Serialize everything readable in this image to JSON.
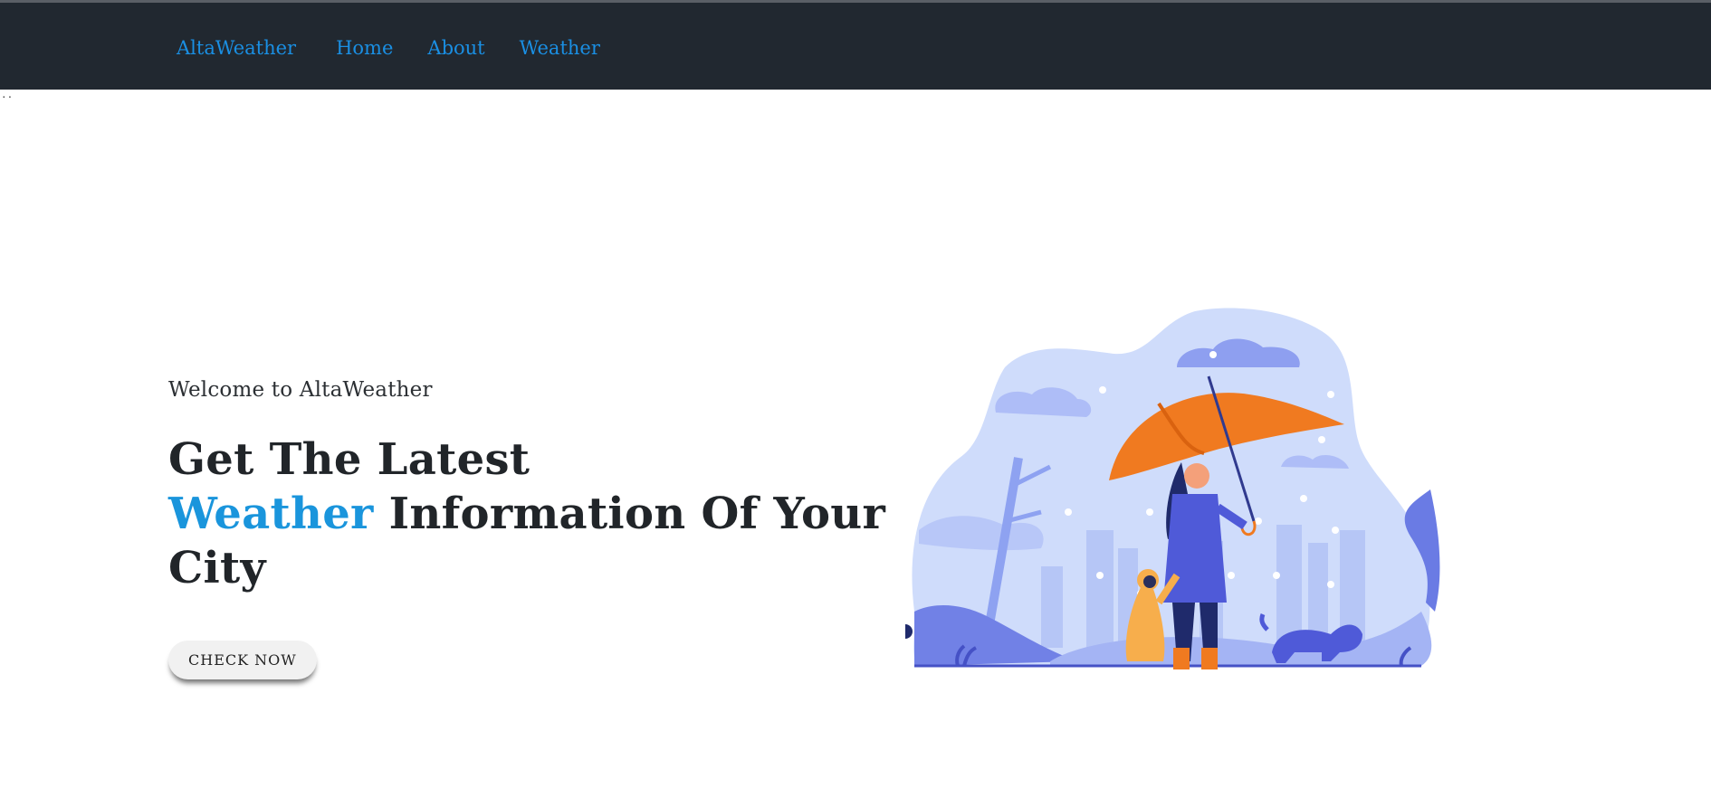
{
  "nav": {
    "brand": "AltaWeather",
    "links": [
      "Home",
      "About",
      "Weather"
    ]
  },
  "stray_text": "..",
  "hero": {
    "welcome": "Welcome to AltaWeather",
    "headline_line1": "Get The Latest",
    "headline_accent": "Weather",
    "headline_rest": "Information Of Your City",
    "cta_label": "CHECK NOW"
  },
  "colors": {
    "navbar_bg": "#212830",
    "link": "#1a8fe3",
    "accent": "#1a95dc",
    "illustration_blob": "#cfdcfb",
    "illustration_dark": "#4f5ad8",
    "umbrella": "#f07a20",
    "child_coat": "#f7ae4c"
  },
  "illustration": {
    "icon": "rain-umbrella-family-illustration"
  }
}
